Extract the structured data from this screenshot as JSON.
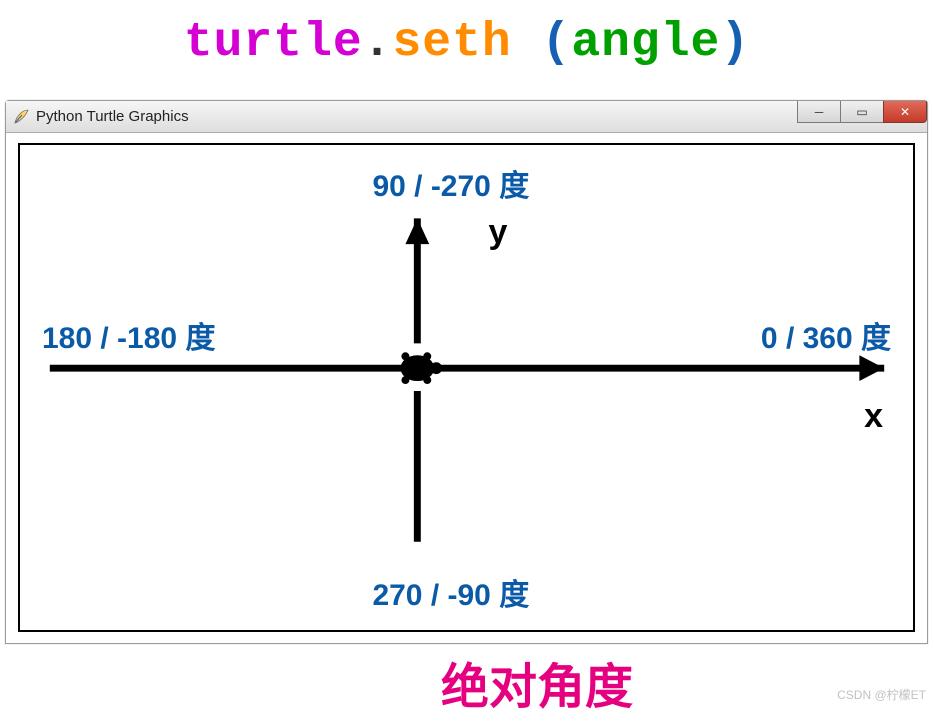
{
  "code_title": {
    "turtle": "turtle",
    "dot": ".",
    "seth": "seth",
    "space": " ",
    "open": " (",
    "angle": "angle",
    "close": ")"
  },
  "window": {
    "title": "Python Turtle Graphics",
    "controls": {
      "minimize": "─",
      "maximize": "▭",
      "close": "✕"
    }
  },
  "diagram": {
    "labels": {
      "top": "90 / -270 度",
      "left": "180 / -180 度",
      "right": "0 / 360 度",
      "bottom": "270 / -90 度"
    },
    "axes": {
      "x": "x",
      "y": "y"
    }
  },
  "bottom_caption": "绝对角度",
  "watermark": "CSDN @柠檬ET",
  "chart_data": {
    "type": "diagram",
    "title": "turtle.seth(angle) 绝对角度",
    "description": "Turtle absolute heading angles on a coordinate plane",
    "axes": [
      "x",
      "y"
    ],
    "turtle_position": {
      "x": 0,
      "y": 0
    },
    "angle_annotations": [
      {
        "direction": "up",
        "primary_deg": 90,
        "alt_deg": -270
      },
      {
        "direction": "left",
        "primary_deg": 180,
        "alt_deg": -180
      },
      {
        "direction": "down",
        "primary_deg": 270,
        "alt_deg": -90
      },
      {
        "direction": "right",
        "primary_deg": 0,
        "alt_deg": 360
      }
    ]
  }
}
